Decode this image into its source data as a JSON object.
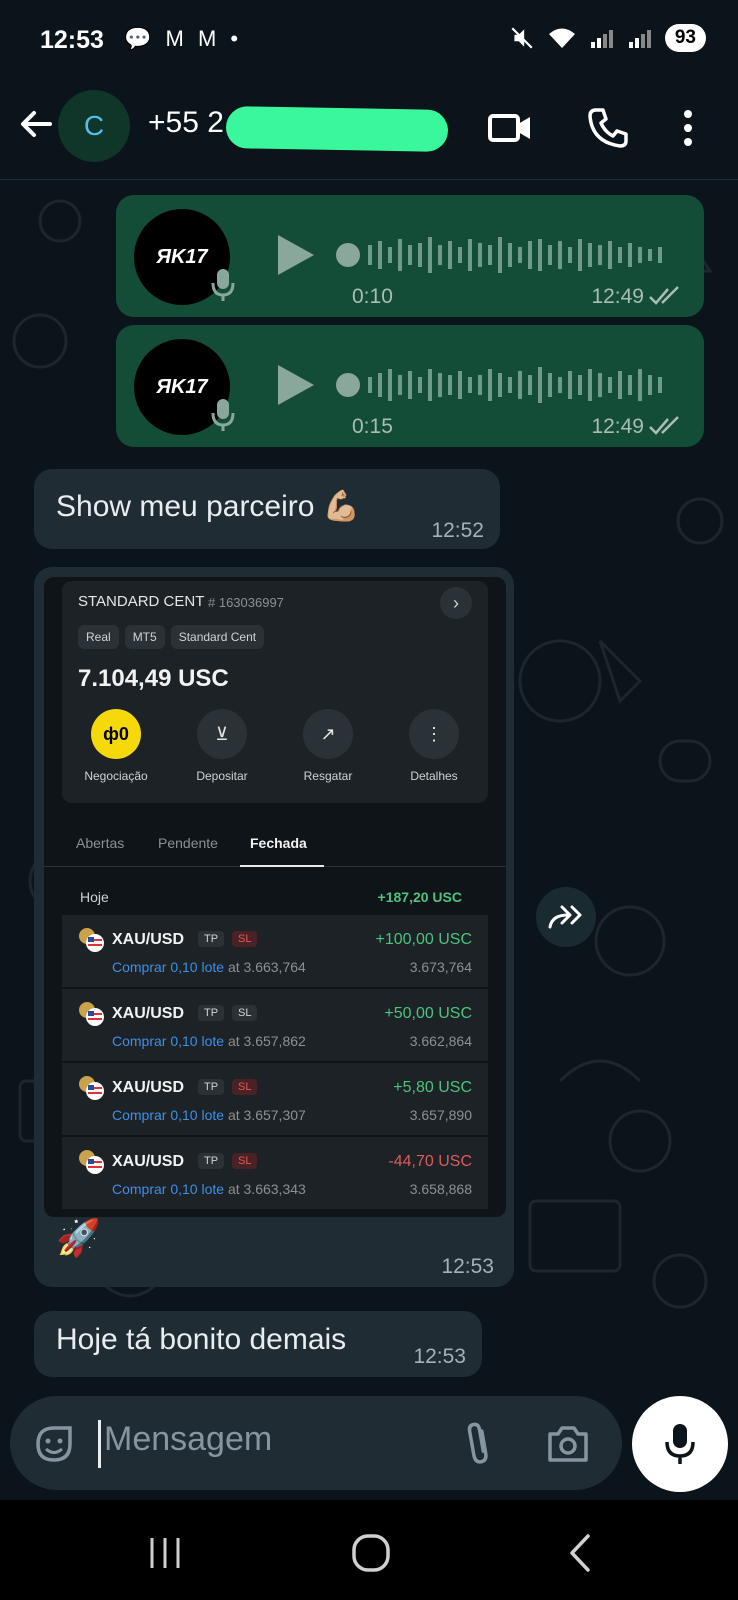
{
  "status_bar": {
    "time": "12:53",
    "left_icons": "💬 M M •",
    "battery": "93"
  },
  "header": {
    "avatar_letter": "C",
    "contact_name": "+55 2"
  },
  "messages": {
    "voice1": {
      "avatar_text": "ЯK17",
      "duration": "0:10",
      "time": "12:49"
    },
    "voice2": {
      "avatar_text": "ЯK17",
      "duration": "0:15",
      "time": "12:49"
    },
    "text1": {
      "text": "Show meu parceiro 💪🏼",
      "time": "12:52"
    },
    "image_msg": {
      "caption": "🚀",
      "time": "12:53"
    },
    "text2": {
      "text": "Hoje tá bonito demais",
      "time": "12:53"
    }
  },
  "screenshot": {
    "account_name": "STANDARD CENT",
    "account_number": "# 163036997",
    "tags": [
      "Real",
      "MT5",
      "Standard Cent"
    ],
    "balance": "7.104,49 USC",
    "actions": [
      {
        "label": "Negociação",
        "icon": "candlestick-icon"
      },
      {
        "label": "Depositar",
        "icon": "download-icon"
      },
      {
        "label": "Resgatar",
        "icon": "withdraw-icon"
      },
      {
        "label": "Detalhes",
        "icon": "more-icon"
      }
    ],
    "tabs": [
      "Abertas",
      "Pendente",
      "Fechada"
    ],
    "active_tab": "Fechada",
    "day_label": "Hoje",
    "day_total": "+187,20 USC",
    "trades": [
      {
        "symbol": "XAU/USD",
        "tp": "TP",
        "sl": "SL",
        "sl_red": true,
        "pnl": "+100,00 USC",
        "positive": true,
        "action": "Comprar 0,10 lote",
        "open_price": "at 3.663,764",
        "close_price": "3.673,764"
      },
      {
        "symbol": "XAU/USD",
        "tp": "TP",
        "sl": "SL",
        "sl_red": false,
        "pnl": "+50,00 USC",
        "positive": true,
        "action": "Comprar 0,10 lote",
        "open_price": "at 3.657,862",
        "close_price": "3.662,864"
      },
      {
        "symbol": "XAU/USD",
        "tp": "TP",
        "sl": "SL",
        "sl_red": true,
        "pnl": "+5,80 USC",
        "positive": true,
        "action": "Comprar 0,10 lote",
        "open_price": "at 3.657,307",
        "close_price": "3.657,890"
      },
      {
        "symbol": "XAU/USD",
        "tp": "TP",
        "sl": "SL",
        "sl_red": true,
        "pnl": "-44,70 USC",
        "positive": false,
        "action": "Comprar 0,10 lote",
        "open_price": "at 3.663,343",
        "close_price": "3.658,868"
      }
    ]
  },
  "input": {
    "placeholder": "Mensagem"
  },
  "colors": {
    "outgoing_bubble": "#144d37",
    "incoming_bubble": "#202c33",
    "background": "#0b141a",
    "accent_green": "#3bf79b"
  }
}
